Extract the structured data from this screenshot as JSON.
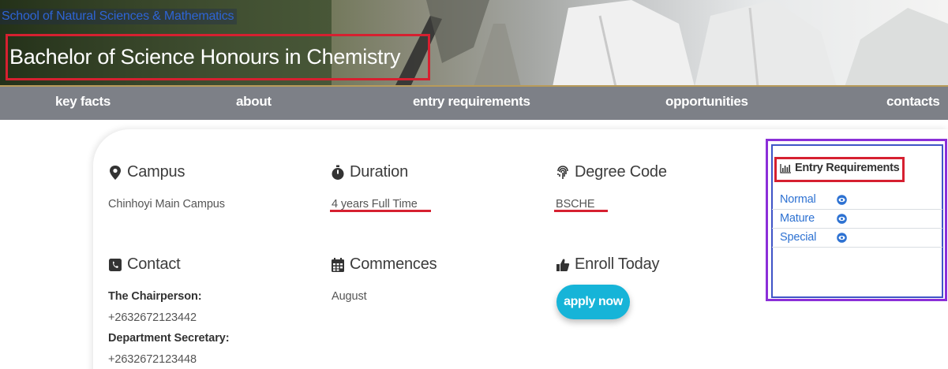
{
  "banner": {
    "school_link": "School of Natural Sciences & Mathematics",
    "program_title": "Bachelor of Science Honours in Chemistry"
  },
  "nav": {
    "items": [
      {
        "label": "key facts"
      },
      {
        "label": "about"
      },
      {
        "label": "entry requirements"
      },
      {
        "label": "opportunities"
      },
      {
        "label": "contacts"
      }
    ]
  },
  "info": {
    "campus": {
      "label": "Campus",
      "value": "Chinhoyi Main Campus",
      "icon": "map-marker-icon"
    },
    "duration": {
      "label": "Duration",
      "value": "4 years Full Time",
      "icon": "stopwatch-icon"
    },
    "degree_code": {
      "label": "Degree Code",
      "value": "BSCHE",
      "icon": "fingerprint-icon"
    },
    "contact": {
      "label": "Contact",
      "icon": "phone-square-icon",
      "chair_title": "The Chairperson:",
      "chair_phone": "+2632672123442",
      "secretary_title": "Department Secretary:",
      "secretary_phone": "+2632672123448"
    },
    "commences": {
      "label": "Commences",
      "value": "August",
      "icon": "calendar-icon"
    },
    "enroll": {
      "label": "Enroll Today",
      "button": "apply now",
      "icon": "thumbs-up-icon"
    }
  },
  "entry_requirements": {
    "title": "Entry Requirements",
    "icon": "bar-chart-icon",
    "items": [
      {
        "label": "Normal",
        "icon": "eye-icon"
      },
      {
        "label": "Mature",
        "icon": "eye-icon"
      },
      {
        "label": "Special",
        "icon": "eye-icon"
      }
    ]
  },
  "colors": {
    "accent_blue": "#2e72d2",
    "annotation_red": "#d62030",
    "annotation_purple": "#8b2fd8",
    "button_cyan": "#16b4d8",
    "nav_gray": "#7d8087"
  }
}
